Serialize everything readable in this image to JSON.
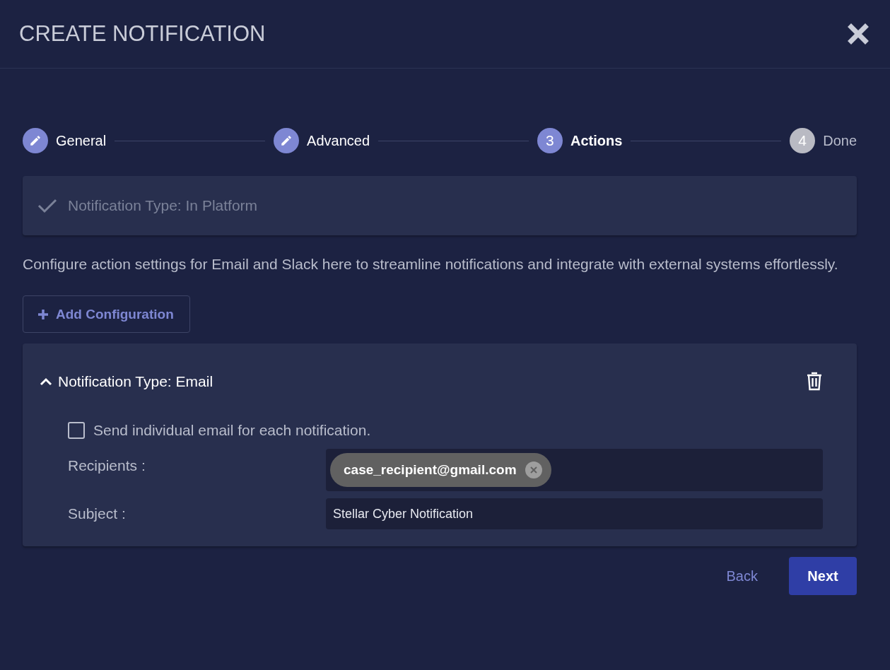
{
  "dialog": {
    "title": "CREATE NOTIFICATION"
  },
  "steps": [
    {
      "label": "General",
      "completed": true,
      "selected": false
    },
    {
      "label": "Advanced",
      "completed": true,
      "selected": false
    },
    {
      "number": "3",
      "label": "Actions",
      "completed": false,
      "selected": true
    },
    {
      "number": "4",
      "label": "Done",
      "completed": false,
      "selected": false
    }
  ],
  "summary": {
    "label": "Notification Type: In Platform",
    "checked": true
  },
  "description": "Configure action settings for Email and Slack here to streamline notifications and integrate with external systems effortlessly.",
  "add_button": "Add Configuration",
  "configuration": {
    "title": "Notification Type: Email",
    "expanded": true,
    "individual_email": {
      "label": "Send individual email for each notification.",
      "checked": false
    },
    "recipients": {
      "label": "Recipients :",
      "chips": [
        "case_recipient@gmail.com"
      ]
    },
    "subject": {
      "label": "Subject :",
      "value": "Stellar Cyber Notification"
    }
  },
  "footer": {
    "back": "Back",
    "next": "Next"
  }
}
